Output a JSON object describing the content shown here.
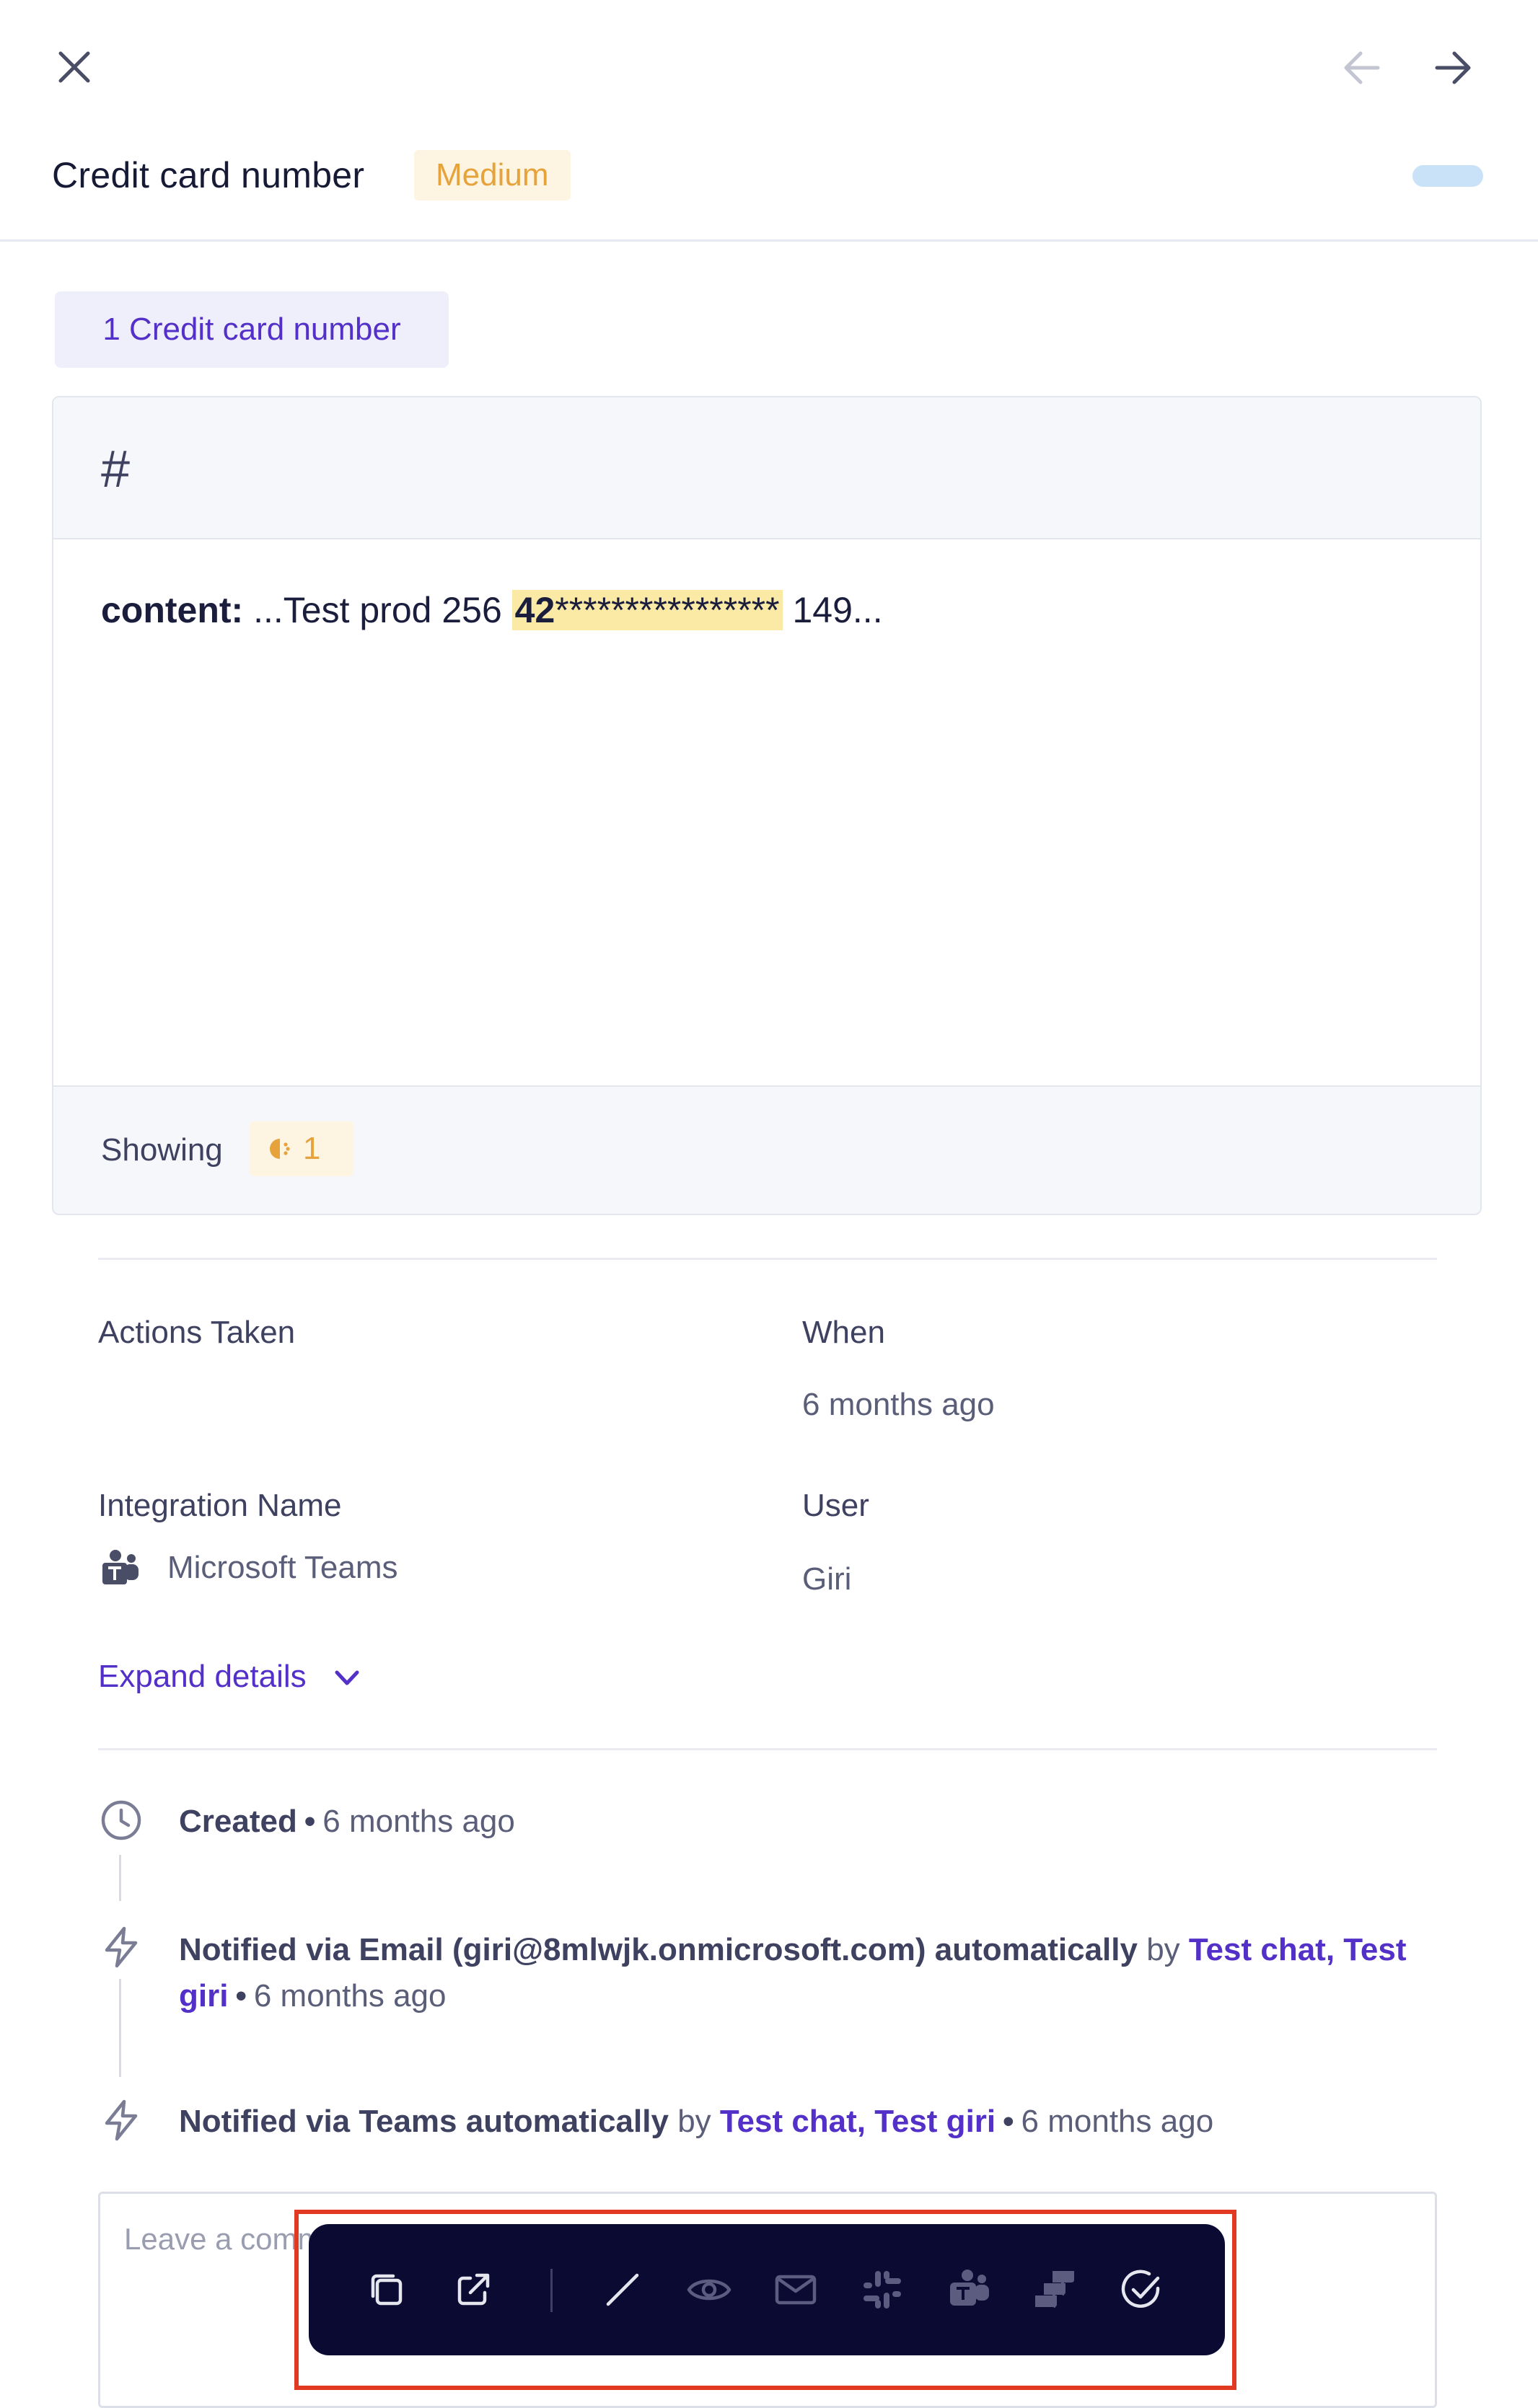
{
  "header": {
    "close_icon": "close-icon",
    "prev_icon": "arrow-left-icon",
    "next_icon": "arrow-right-icon",
    "title": "Credit card number",
    "severity": "Medium",
    "colors": {
      "severity_bg": "#fdf5e2",
      "severity_text": "#e7a33b",
      "accent": "#5330c8"
    }
  },
  "match_tag": "1 Credit card number",
  "card": {
    "icon": "hash-icon",
    "content_label": "content:",
    "content_prefix": " ...Test prod 256 ",
    "match_bold": "42",
    "match_masked": "****************",
    "content_suffix": " 149...",
    "showing_label": "Showing",
    "showing_count": "1"
  },
  "details": {
    "actions_taken_label": "Actions Taken",
    "when_label": "When",
    "when_value": "6 months ago",
    "integration_label": "Integration Name",
    "integration_value": "Microsoft Teams",
    "user_label": "User",
    "user_value": "Giri",
    "expand_label": "Expand details"
  },
  "timeline": [
    {
      "icon": "clock-icon",
      "event": "Created",
      "time": "6 months ago"
    },
    {
      "icon": "lightning-icon",
      "event": "Notified via Email (giri@8mlwjk.onmicrosoft.com) automatically",
      "by": "by",
      "actors": "Test chat, Test giri",
      "time": "6 months ago"
    },
    {
      "icon": "lightning-icon",
      "event": "Notified via Teams automatically",
      "by": "by",
      "actors": "Test chat, Test giri",
      "time": "6 months ago"
    }
  ],
  "comment": {
    "placeholder": "Leave a comment"
  },
  "toolbar": {
    "items": [
      "copy-icon",
      "external-link-icon",
      "slash-icon",
      "eye-icon",
      "mail-icon",
      "slack-icon",
      "teams-icon",
      "jira-icon",
      "check-circle-icon"
    ]
  }
}
